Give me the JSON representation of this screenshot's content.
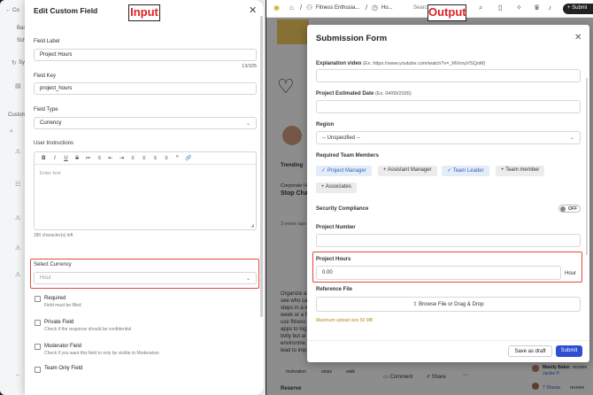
{
  "left_panel": {
    "background_app": {
      "items": [
        "Co",
        "Bas",
        "Sch",
        "Sy",
        "Custom"
      ]
    },
    "drawer": {
      "title": "Edit Custom Field",
      "field_label": {
        "label": "Field Label",
        "value": "Project Hours",
        "counter": "13/325"
      },
      "field_key": {
        "label": "Field Key",
        "value": "project_hours"
      },
      "field_type": {
        "label": "Field Type",
        "value": "Currency"
      },
      "instructions": {
        "label": "User Instructions",
        "placeholder": "Enter text",
        "remaining": "280 character(s) left",
        "toolbar": [
          "B",
          "I",
          "U",
          "S",
          "≔",
          "≡",
          "⇤",
          "⇥",
          "≡",
          "≡",
          "≡",
          "≡",
          "”",
          "🔗"
        ]
      },
      "select_currency": {
        "label": "Select Currency",
        "placeholder": "Hour"
      },
      "options": [
        {
          "title": "Required",
          "subtitle": "Field must be filled"
        },
        {
          "title": "Private Field",
          "subtitle": "Check if the response should be confidential"
        },
        {
          "title": "Moderator Field",
          "subtitle": "Check if you want this field to only be visible to Moderators"
        },
        {
          "title": "Team Only Field",
          "subtitle": ""
        }
      ]
    },
    "tag": "Input"
  },
  "right_panel": {
    "topbar": {
      "breadcrumb_1": "Fitness Enthusia...",
      "breadcrumb_2": "Ho...",
      "search": "Search",
      "submit": "Submi"
    },
    "behind": {
      "trending": "Trending",
      "corporate": "Corporate H",
      "stop": "Stop Chal",
      "years": "3 years ago",
      "organize": [
        "Organize a",
        "see who ca",
        "steps in a w",
        "week or a h",
        "use fitness",
        "apps to log",
        "tivity but al",
        "environme",
        "lead to imp"
      ],
      "motivation": "motivation",
      "steps": "steps",
      "walk": "walk",
      "comment": "Comment",
      "share": "Share",
      "reserve": "Reserve",
      "mandy": "Mandy Baker",
      "mandy_sub": "Jackie P.",
      "received": "receive",
      "shasta": "T Shasta",
      "received_2": "receive"
    },
    "modal": {
      "title": "Submission Form",
      "explanation_video": {
        "label": "Explanation video",
        "hint": "(Ex. https://www.youtube.com/watch?v=_MVonyVSQoM)"
      },
      "estimated_date": {
        "label": "Project Estimated Date",
        "hint": "(Ex. 04/09/2026)"
      },
      "region": {
        "label": "Region",
        "value": "-- Unspecified --"
      },
      "team_members": {
        "label": "Required Team Members",
        "chips": [
          {
            "label": "Project Manager",
            "selected": true
          },
          {
            "label": "Assistant Manager",
            "selected": false
          },
          {
            "label": "Team Leader",
            "selected": true
          },
          {
            "label": "Team member",
            "selected": false
          },
          {
            "label": "Associates",
            "selected": false
          }
        ]
      },
      "security": {
        "label": "Security Compliance",
        "toggle": "OFF"
      },
      "project_number": {
        "label": "Project Number"
      },
      "project_hours": {
        "label": "Project Hours",
        "value": "0.00",
        "unit": "Hour"
      },
      "reference_file": {
        "label": "Reference File",
        "button": "Browse File or Drag & Drop",
        "hint": "Maximum upload size 50 MB"
      },
      "save_draft": "Save as draft",
      "submit": "Submit"
    },
    "tag": "Output"
  },
  "colors": {
    "annotation": "#e04b3a",
    "primary": "#2f4ed1",
    "chip_selected": "#2f64b8"
  }
}
